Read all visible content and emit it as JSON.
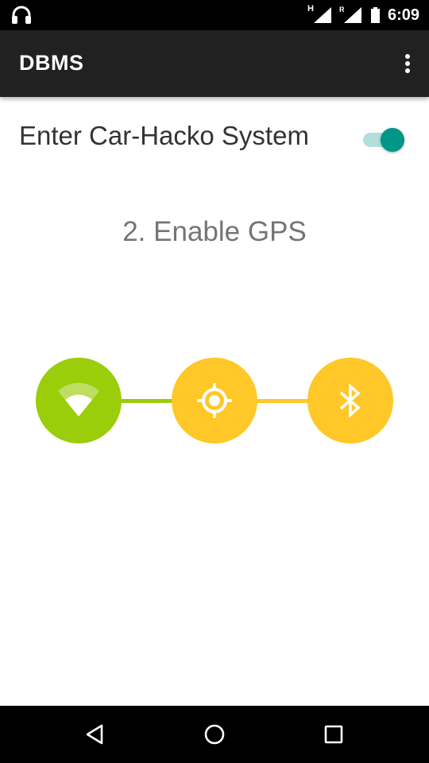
{
  "status_bar": {
    "left_icon": "headset-icon",
    "network_badge": "H",
    "roaming_badge": "R",
    "time": "6:09",
    "icons": [
      "signal-icon",
      "roaming-signal-icon",
      "battery-icon"
    ]
  },
  "app_bar": {
    "title": "DBMS",
    "menu_icon": "more-vert-icon"
  },
  "toggle": {
    "label": "Enter Car-Hacko System",
    "state": "on"
  },
  "step": {
    "title": "2. Enable GPS"
  },
  "stepper": {
    "steps": [
      {
        "icon": "wifi-icon",
        "status": "completed",
        "color": "#9acd0a"
      },
      {
        "icon": "gps-location-icon",
        "status": "current",
        "color": "#ffc728"
      },
      {
        "icon": "bluetooth-icon",
        "status": "pending",
        "color": "#ffc728"
      }
    ],
    "connector_colors": [
      "#9acd0a",
      "#ffc728"
    ]
  },
  "nav_bar": {
    "buttons": [
      "back-icon",
      "home-icon",
      "recents-icon"
    ]
  }
}
